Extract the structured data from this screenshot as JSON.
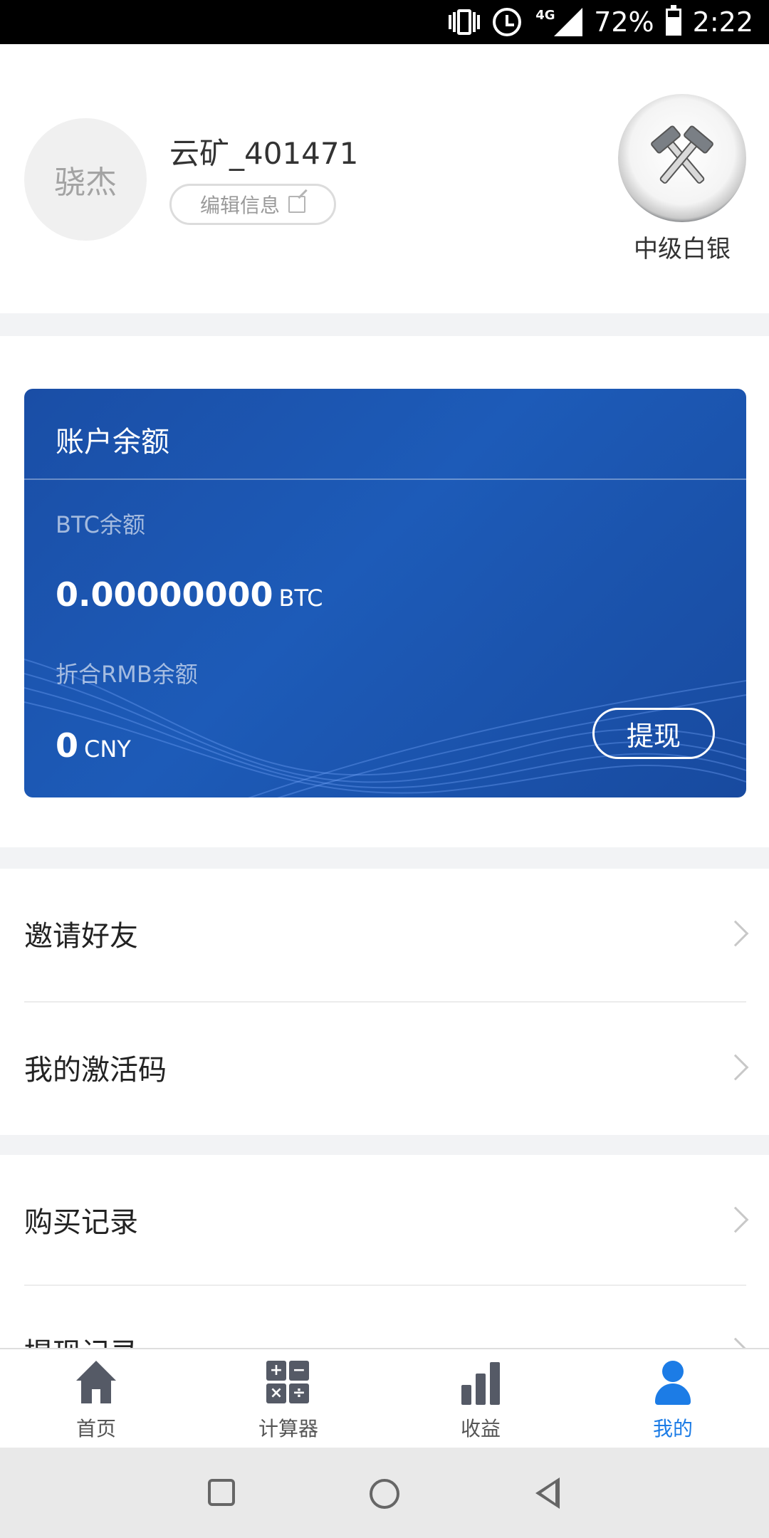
{
  "status_bar": {
    "battery": "72%",
    "time": "2:22",
    "network": "4G",
    "battery_level": 0.72
  },
  "profile": {
    "avatar_text": "骁杰",
    "username": "云矿_401471",
    "edit_label": "编辑信息",
    "level": "中级白银"
  },
  "balance_card": {
    "title": "账户余额",
    "btc_label": "BTC余额",
    "btc_value": "0.00000000",
    "btc_unit": "BTC",
    "rmb_label": "折合RMB余额",
    "rmb_value": "0",
    "rmb_unit": "CNY",
    "withdraw_label": "提现"
  },
  "menu": {
    "invite": "邀请好友",
    "activation_code": "我的激活码",
    "purchase_records": "购买记录",
    "withdraw_records": "提现记录"
  },
  "tabs": [
    {
      "label": "首页",
      "icon": "home-icon"
    },
    {
      "label": "计算器",
      "icon": "calculator-icon"
    },
    {
      "label": "收益",
      "icon": "bar-chart-icon"
    },
    {
      "label": "我的",
      "icon": "user-icon",
      "active": true
    }
  ],
  "colors": {
    "accent": "#1c7ce6",
    "card_bg": "#1d5bb8",
    "gap_bg": "#f2f3f5"
  }
}
